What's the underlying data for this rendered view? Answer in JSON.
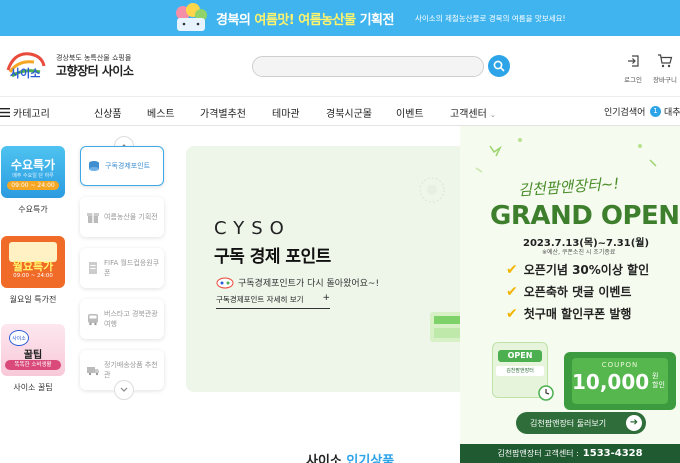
{
  "banner": {
    "title_pre": "경북의 ",
    "title_hl": "여름맛! 여름농산물",
    "title_post": " 기획전",
    "subtitle": "사이소의 제철농산물로 경북의 여름을 맛보세요!"
  },
  "header": {
    "logo_text": "사이소",
    "logo_sub": "경상북도 농특산물 쇼핑몰",
    "logo_main": "고향장터 사이소",
    "search_placeholder": "",
    "login_label": "로그인",
    "cart_label": "장바구니"
  },
  "nav": {
    "category_label": "카테고리",
    "items": [
      "신상품",
      "베스트",
      "가격별추천",
      "테마관",
      "경북시군몰",
      "이벤트",
      "고객센터"
    ],
    "popular_label": "인기검색어",
    "popular_rank": "1",
    "popular_word": "대추"
  },
  "left": {
    "items": [
      {
        "label": "수요특가",
        "card_title": "수요특가",
        "card_sub": "매주 수요일 단 하루",
        "card_time": "09:00 ~ 24:00"
      },
      {
        "label": "월요일 특가전",
        "card_title": "월요특가",
        "card_time": "09:00 ~ 24:00"
      },
      {
        "label": "사이소 꿀팁",
        "card_title": "꿀팁",
        "card_sub": "똑똑한 소비생활"
      }
    ]
  },
  "tabs": [
    {
      "text": "구독경제포인트"
    },
    {
      "text": "여름농산물 기획전"
    },
    {
      "text": "FIFA 월드컵응원쿠폰"
    },
    {
      "text": "버스타고 경북관광 여행"
    },
    {
      "text": "정기배송상품 추천관"
    }
  ],
  "main": {
    "cyso": "CYSO",
    "title": "구독 경제 포인트",
    "desc": "구독경제포인트가 다시 돌아왔어요~!",
    "link": "구독경제포인트 자세히 보기",
    "link_plus": "+"
  },
  "popup": {
    "script": "김천팜앤장터~!",
    "grand": "GRAND OPEN",
    "date": "2023.7.13(목)~7.31(월)",
    "note": "※예산, 쿠폰소진 시 조기종료",
    "lines": [
      "오픈기념 30%이상 할인",
      "오픈축하 댓글 이벤트",
      "첫구매 할인쿠폰 발행"
    ],
    "open_sign": "OPEN",
    "shop_sign": "김천팜앤장터",
    "coupon_label": "COUPON",
    "coupon_amount": "10,000",
    "coupon_unit_1": "원",
    "coupon_unit_2": "할인",
    "button": "김천팜앤장터 둘러보기",
    "footer_label": "김천팜앤장터 고객센터 :",
    "footer_phone": "1533-4328"
  },
  "bottom": {
    "title_pre": "사이소 ",
    "title_hl": "인기상품"
  },
  "colors": {
    "brand_blue": "#3fb4ee",
    "popup_green": "#3e7f2d",
    "footer_green": "#1f5a30"
  }
}
